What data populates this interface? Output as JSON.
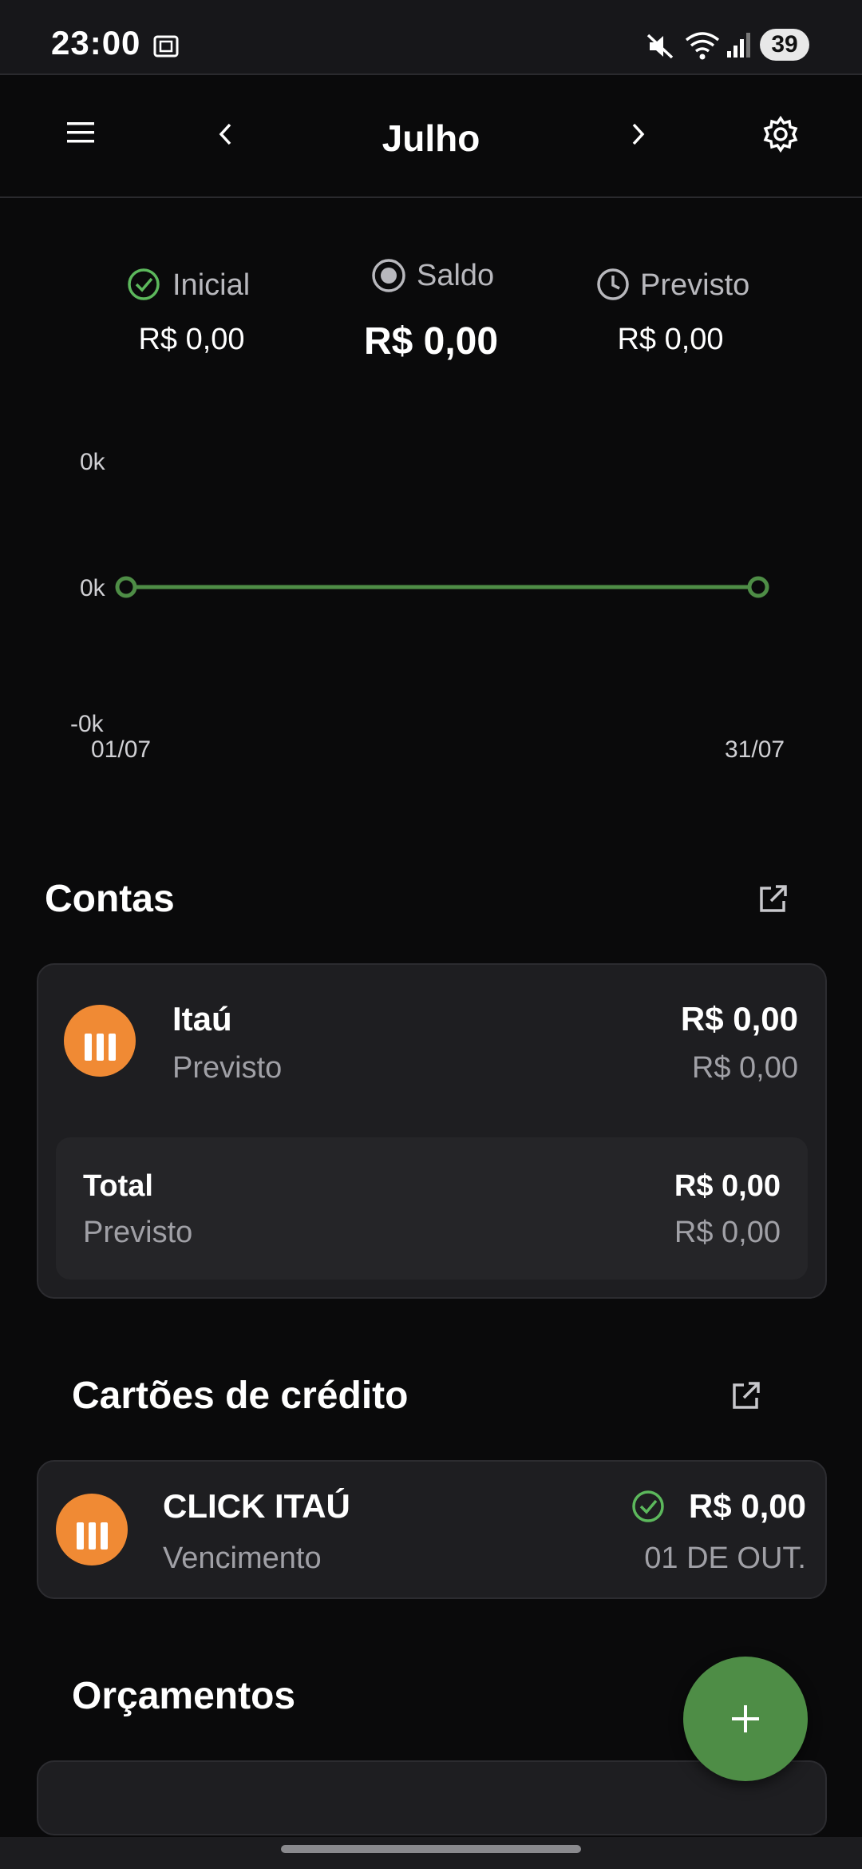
{
  "status": {
    "time": "23:00",
    "battery": "39"
  },
  "header": {
    "month": "Julho"
  },
  "summary": {
    "inicial_label": "Inicial",
    "inicial_value": "R$ 0,00",
    "saldo_label": "Saldo",
    "saldo_value": "R$ 0,00",
    "previsto_label": "Previsto",
    "previsto_value": "R$ 0,00"
  },
  "chart_data": {
    "type": "line",
    "x": [
      "01/07",
      "31/07"
    ],
    "series": [
      {
        "values": [
          0,
          0
        ]
      }
    ],
    "yticks": [
      "0k",
      "0k",
      "-0k"
    ],
    "xticks": [
      "01/07",
      "31/07"
    ],
    "color": "#4e8d46",
    "grid": false
  },
  "accounts": {
    "title": "Contas",
    "items": [
      {
        "name": "Itaú",
        "sub": "Previsto",
        "amount": "R$ 0,00",
        "forecast": "R$ 0,00"
      }
    ],
    "total": {
      "label": "Total",
      "sub": "Previsto",
      "amount": "R$ 0,00",
      "forecast": "R$ 0,00"
    }
  },
  "cards": {
    "title": "Cartões de crédito",
    "items": [
      {
        "name": "CLICK ITAÚ",
        "sub": "Vencimento",
        "amount": "R$ 0,00",
        "due": "01 DE OUT."
      }
    ]
  },
  "budgets": {
    "title": "Orçamentos"
  },
  "colors": {
    "accent": "#4e8d46",
    "bank": "#f08a34",
    "background": "#0a0a0b",
    "card": "#1e1e21"
  }
}
